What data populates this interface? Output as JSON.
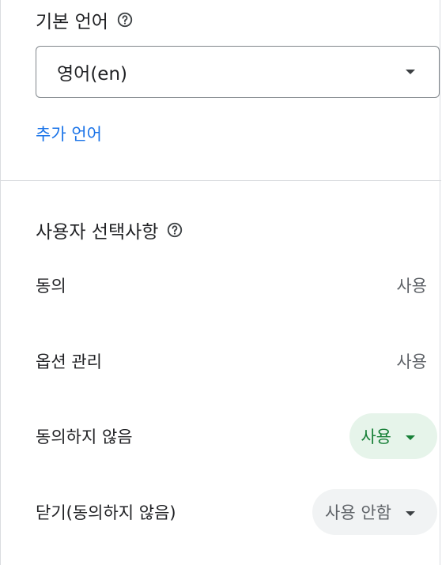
{
  "language": {
    "title": "기본 언어",
    "help_icon": "help-circle-icon",
    "selected": "영어(en)",
    "add_language_link": "추가 언어"
  },
  "preferences": {
    "title": "사용자 선택사항",
    "help_icon": "help-circle-icon",
    "rows": [
      {
        "label": "동의",
        "value": "사용",
        "type": "text"
      },
      {
        "label": "옵션 관리",
        "value": "사용",
        "type": "text"
      },
      {
        "label": "동의하지 않음",
        "value": "사용",
        "type": "chip-enabled"
      },
      {
        "label": "닫기(동의하지 않음)",
        "value": "사용 안함",
        "type": "chip-disabled"
      }
    ]
  },
  "colors": {
    "link": "#1a73e8",
    "enabled_chip_bg": "#e6f4ea",
    "enabled_chip_text": "#188038",
    "disabled_chip_bg": "#f1f3f4"
  }
}
